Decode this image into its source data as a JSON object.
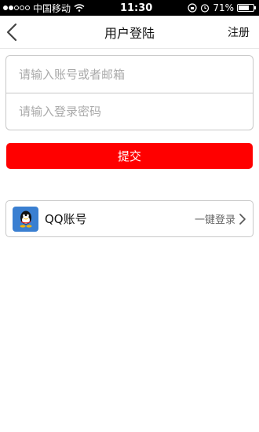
{
  "status_bar": {
    "carrier": "中国移动",
    "time": "11:30",
    "battery": "71%",
    "battery_level": 0.71
  },
  "nav": {
    "title": "用户登陆",
    "right_action": "注册"
  },
  "form": {
    "account_placeholder": "请输入账号或者邮箱",
    "password_placeholder": "请输入登录密码",
    "account_value": "",
    "password_value": "",
    "submit_label": "提交"
  },
  "third_party": {
    "qq_label": "QQ账号",
    "qq_action": "一键登录"
  },
  "colors": {
    "accent": "#ff0000",
    "qq_blue": "#3a7fd1"
  }
}
